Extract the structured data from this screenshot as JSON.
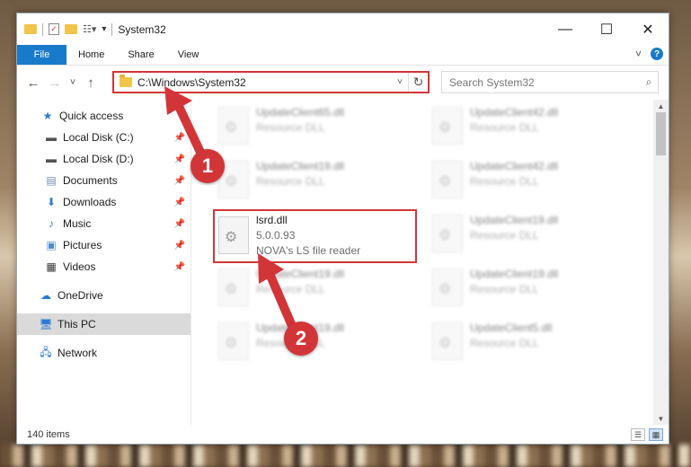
{
  "window": {
    "title": "System32",
    "controls": {
      "minimize": "—",
      "maximize": "☐",
      "close": "✕"
    }
  },
  "ribbon": {
    "tabs": [
      "File",
      "Home",
      "Share",
      "View"
    ],
    "expand_icon": "˅",
    "help_icon": "?"
  },
  "navigation": {
    "back": "←",
    "forward": "→",
    "recent": "˅",
    "up": "↑"
  },
  "address": {
    "path": "C:\\Windows\\System32",
    "dropdown": "˅",
    "refresh": "↻"
  },
  "search": {
    "placeholder": "Search System32",
    "icon": "⌕"
  },
  "sidebar": {
    "quick_access": "Quick access",
    "pinned": [
      {
        "label": "Local Disk (C:)",
        "icon": "drive-icon"
      },
      {
        "label": "Local Disk (D:)",
        "icon": "drive-icon"
      },
      {
        "label": "Documents",
        "icon": "documents-icon"
      },
      {
        "label": "Downloads",
        "icon": "downloads-icon"
      },
      {
        "label": "Music",
        "icon": "music-icon"
      },
      {
        "label": "Pictures",
        "icon": "pictures-icon"
      },
      {
        "label": "Videos",
        "icon": "videos-icon"
      }
    ],
    "onedrive": "OneDrive",
    "this_pc": "This PC",
    "network": "Network"
  },
  "files": {
    "left_column": [
      {
        "name": "UpdateClient65.dll",
        "desc": "Resource DLL"
      },
      {
        "name": "UpdateClient19.dll",
        "desc": "Resource DLL"
      },
      {
        "name": "lsrd.dll",
        "version": "5.0.0.93",
        "desc": "NOVA's LS file reader"
      },
      {
        "name": "UpdateClient19.dll",
        "desc": "Resource DLL"
      },
      {
        "name": "UpdateClient19.dll",
        "desc": "Resource DLL"
      }
    ],
    "right_column": [
      {
        "name": "UpdateClient42.dll",
        "desc": "Resource DLL"
      },
      {
        "name": "UpdateClient42.dll",
        "desc": "Resource DLL"
      },
      {
        "name": "UpdateClient19.dll",
        "desc": "Resource DLL"
      },
      {
        "name": "UpdateClient19.dll",
        "desc": "Resource DLL"
      },
      {
        "name": "UpdateClient5.dll",
        "desc": "Resource DLL"
      }
    ]
  },
  "status": {
    "count": "140 items"
  },
  "annotations": {
    "step1": "1",
    "step2": "2",
    "color": "#d23538"
  }
}
